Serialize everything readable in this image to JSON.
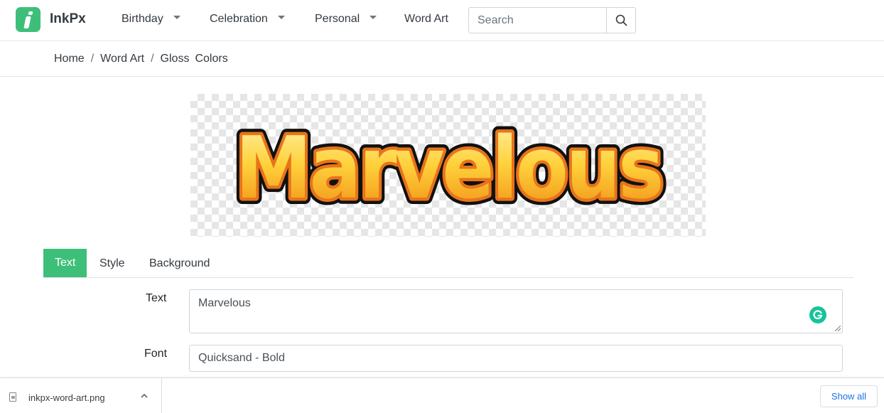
{
  "navbar": {
    "brand": "InkPx",
    "items": [
      {
        "label": "Birthday"
      },
      {
        "label": "Celebration"
      },
      {
        "label": "Personal"
      },
      {
        "label": "Word Art"
      }
    ],
    "search_placeholder": "Search"
  },
  "breadcrumb": {
    "items": [
      "Home",
      "Word Art",
      "Gloss"
    ],
    "current": "Colors",
    "separator": "/"
  },
  "preview": {
    "word_art_text": "Marvelous",
    "fill_top_color": "#fff1a8",
    "fill_bottom_color": "#f08a12",
    "stroke_color": "#111111"
  },
  "tabs": [
    {
      "label": "Text"
    },
    {
      "label": "Style"
    },
    {
      "label": "Background"
    }
  ],
  "form": {
    "text_label": "Text",
    "text_value": "Marvelous",
    "font_label": "Font",
    "font_value": "Quicksand - Bold"
  },
  "download_shelf": {
    "filename": "inkpx-word-art.png",
    "show_all_label": "Show all"
  },
  "colors": {
    "accent": "#3dbf7a",
    "grammarly": "#15c39a",
    "link_blue": "#1a73e8"
  }
}
